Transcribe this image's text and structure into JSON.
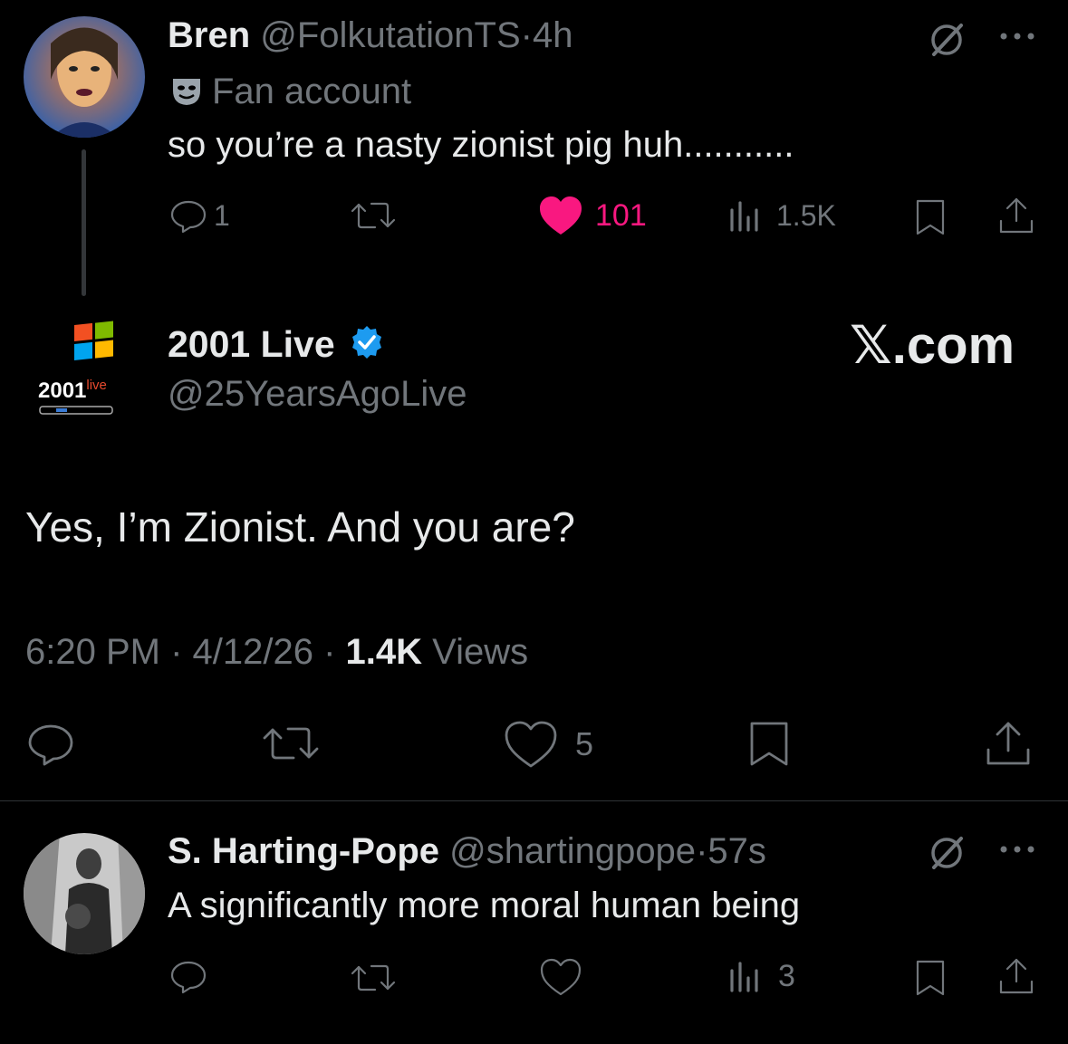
{
  "tweets": [
    {
      "display_name": "Bren",
      "handle": "@FolkutationTS",
      "separator": "·",
      "time": "4h",
      "badge_label": "Fan account",
      "text": "so you’re a nasty zionist pig huh...........",
      "replies": "1",
      "likes": "101",
      "views": "1.5K"
    },
    {
      "display_name": "2001 Live",
      "handle": "@25YearsAgoLive",
      "avatar_text": "2001",
      "avatar_sup": "live",
      "text": "Yes, I’m Zionist. And you are?",
      "time": "6:20 PM",
      "date": "4/12/26",
      "views_count": "1.4K",
      "views_label": "Views",
      "likes": "5"
    },
    {
      "display_name": "S. Harting-Pope",
      "handle": "@shartingpope",
      "separator": "·",
      "time": "57s",
      "text": "A significantly more moral human being",
      "views": "3"
    }
  ],
  "watermark": "𝕏.com",
  "colors": {
    "background": "#000000",
    "primary_text": "#e7e9ea",
    "secondary_text": "#71767b",
    "like_active": "#f91880",
    "verified": "#1d9bf0"
  }
}
